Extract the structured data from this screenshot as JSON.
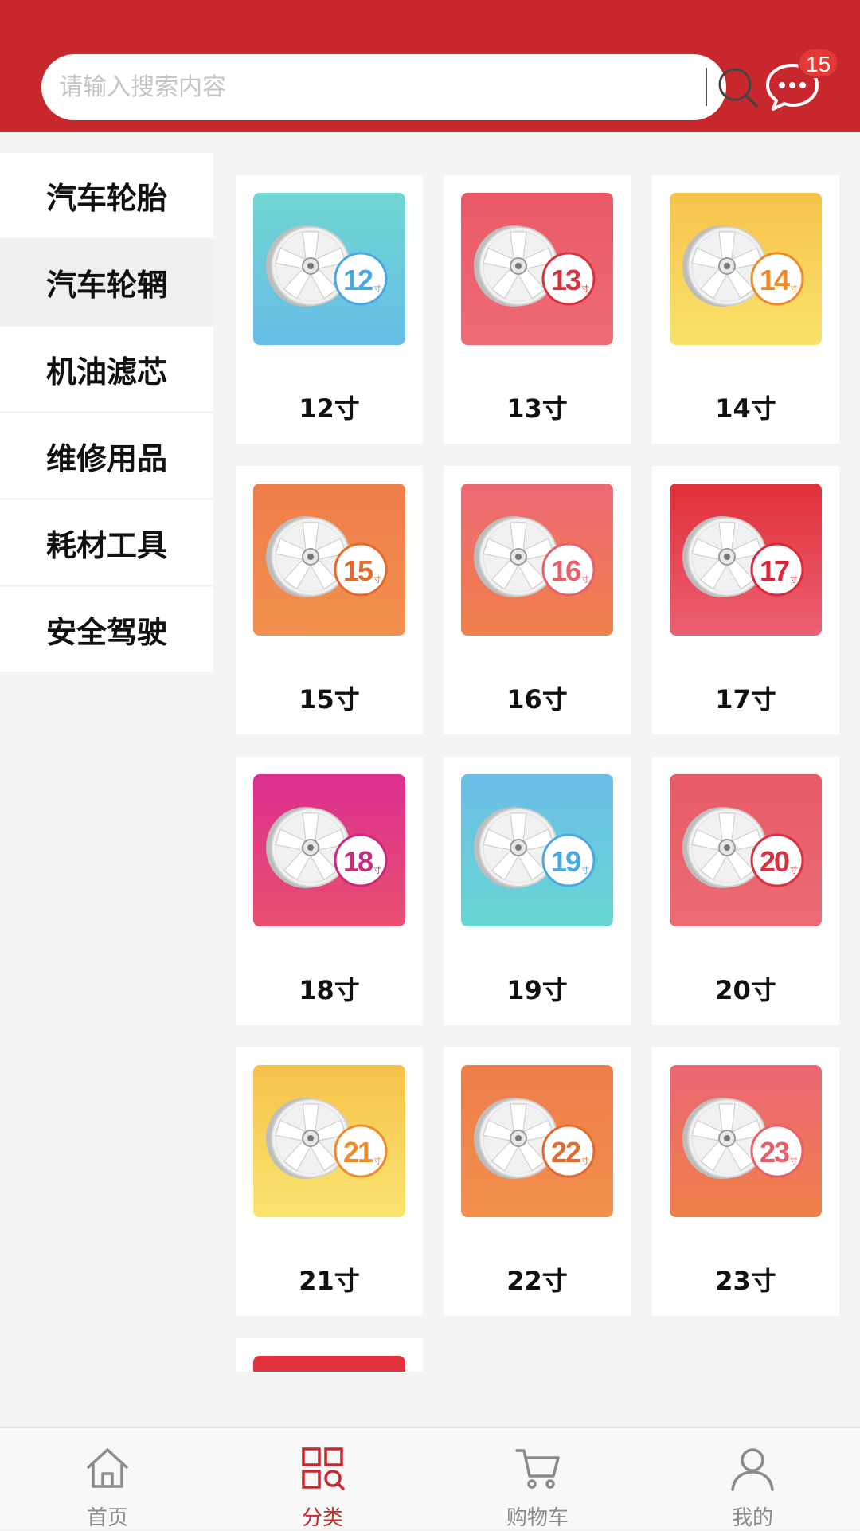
{
  "search": {
    "placeholder": "请输入搜索内容"
  },
  "messages": {
    "badge_count": "15"
  },
  "sidebar": {
    "items": [
      {
        "label": "汽车轮胎",
        "active": false
      },
      {
        "label": "汽车轮辋",
        "active": true
      },
      {
        "label": "机油滤芯",
        "active": false
      },
      {
        "label": "维修用品",
        "active": false
      },
      {
        "label": "耗材工具",
        "active": false
      },
      {
        "label": "安全驾驶",
        "active": false
      }
    ]
  },
  "products": [
    {
      "label": "12寸",
      "size": "12",
      "gradient": [
        "#6fd6d2",
        "#66bde6"
      ],
      "accent": "#4aa8e0"
    },
    {
      "label": "13寸",
      "size": "13",
      "gradient": [
        "#ea5a66",
        "#ee6b76"
      ],
      "accent": "#d9323f"
    },
    {
      "label": "14寸",
      "size": "14",
      "gradient": [
        "#f6c24a",
        "#fae36b"
      ],
      "accent": "#ef8a2a"
    },
    {
      "label": "15寸",
      "size": "15",
      "gradient": [
        "#ee7d4a",
        "#f2904d"
      ],
      "accent": "#e36a2e"
    },
    {
      "label": "16寸",
      "size": "16",
      "gradient": [
        "#ee6874",
        "#f08149"
      ],
      "accent": "#e6606a"
    },
    {
      "label": "17寸",
      "size": "17",
      "gradient": [
        "#e1313a",
        "#ec6072"
      ],
      "accent": "#d9283a"
    },
    {
      "label": "18寸",
      "size": "18",
      "gradient": [
        "#db2f8f",
        "#e8506f"
      ],
      "accent": "#c92a7d"
    },
    {
      "label": "19寸",
      "size": "19",
      "gradient": [
        "#6abde8",
        "#68d6d2"
      ],
      "accent": "#4aa8e0"
    },
    {
      "label": "20寸",
      "size": "20",
      "gradient": [
        "#e75b66",
        "#ec6b74"
      ],
      "accent": "#d9323f"
    },
    {
      "label": "21寸",
      "size": "21",
      "gradient": [
        "#f6c24a",
        "#fae470"
      ],
      "accent": "#ef8a2a"
    },
    {
      "label": "22寸",
      "size": "22",
      "gradient": [
        "#ee7d4a",
        "#f2904d"
      ],
      "accent": "#e36a2e"
    },
    {
      "label": "23寸",
      "size": "23",
      "gradient": [
        "#ec6674",
        "#f08049"
      ],
      "accent": "#e6606a"
    },
    {
      "label": "",
      "size": "",
      "gradient": [
        "#e1313a",
        "#ec6072"
      ],
      "accent": "#d9283a"
    }
  ],
  "tabbar": {
    "items": [
      {
        "label": "首页",
        "icon": "home-icon",
        "active": false
      },
      {
        "label": "分类",
        "icon": "category-icon",
        "active": true
      },
      {
        "label": "购物车",
        "icon": "cart-icon",
        "active": false
      },
      {
        "label": "我的",
        "icon": "user-icon",
        "active": false
      }
    ]
  },
  "colors": {
    "brand": "#c8282d",
    "inactive": "#8a8a8a"
  }
}
